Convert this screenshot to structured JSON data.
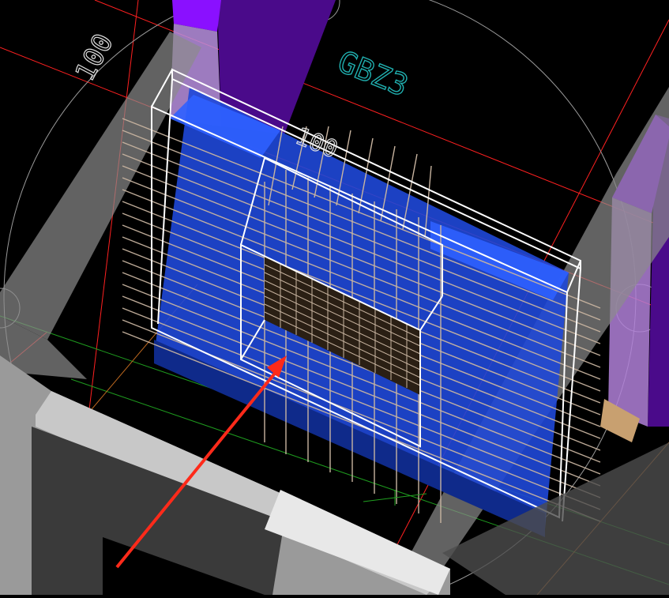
{
  "viewport": {
    "background": "#000000",
    "labels": {
      "element_tag": "GBZ3",
      "dim_left": "100",
      "dim_center": "100"
    },
    "colors": {
      "slab_blue": "#1f48d8",
      "wall_purple": "#4a0a8a",
      "wall_violet": "#8a10ff",
      "column_gray": "#8c8c8c",
      "beam_light": "#e8e8e8",
      "rebar": "#c8b4a0",
      "frame": "#ffffff",
      "axis_red": "#ff2020",
      "axis_green": "#20a020",
      "annotation_cyan": "#20b0b0",
      "arrow_red": "#ff2a1a"
    }
  }
}
